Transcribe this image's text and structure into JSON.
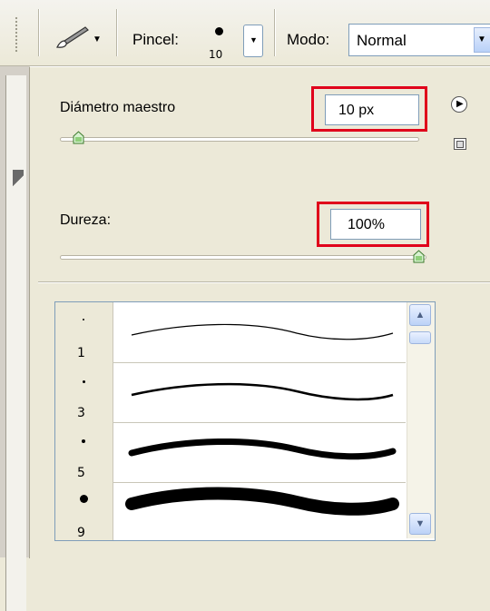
{
  "options_bar": {
    "tool_icon": "brush-tool-icon",
    "tool_arrow_glyph": "▼",
    "pincel_label": "Pincel:",
    "brush_preset_size": "10",
    "preset_dropdown_glyph": "▼",
    "modo_label": "Modo:",
    "modo_value": "Normal",
    "modo_dropdown_glyph": "▼"
  },
  "brush_panel": {
    "diameter_label": "Diámetro maestro",
    "diameter_value": "10 px",
    "hardness_label": "Dureza:",
    "hardness_value": "100%",
    "diameter_slider_level": 0.05,
    "hardness_slider_level": 1.0,
    "flyout_glyph": "▶",
    "highlight_color": "#e0001b"
  },
  "brush_list": [
    {
      "size": "1"
    },
    {
      "size": "3"
    },
    {
      "size": "5"
    },
    {
      "size": "9"
    }
  ],
  "scrollbar": {
    "up_glyph": "▲",
    "down_glyph": "▼"
  }
}
